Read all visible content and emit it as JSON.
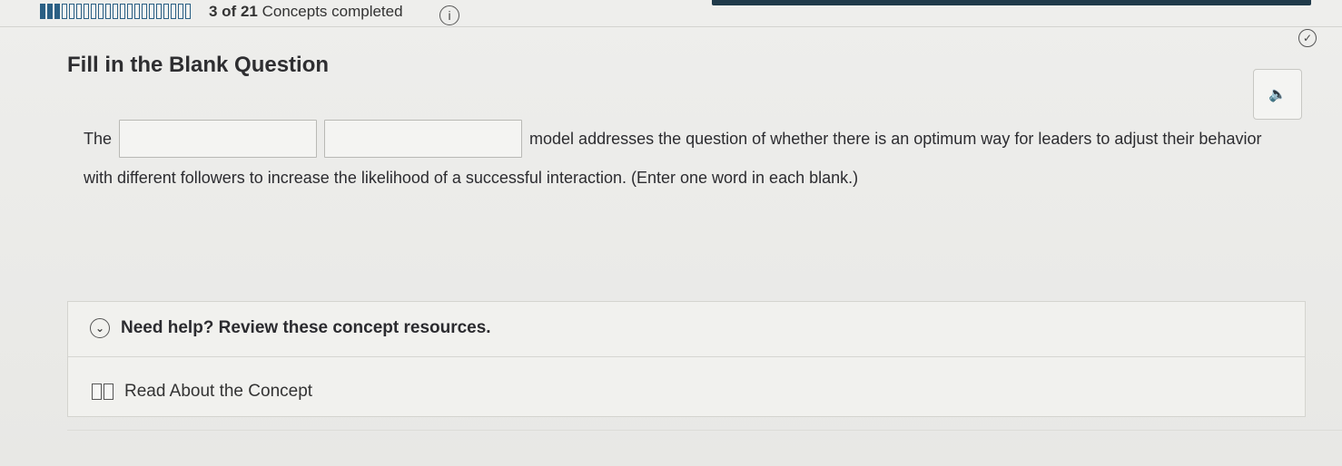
{
  "header": {
    "progress_completed": 3,
    "progress_total": 21,
    "progress_label_bold": "3 of 21",
    "progress_label_rest": "Concepts completed",
    "info_icon": "i",
    "accent_color": "#203a4a",
    "progress_color": "#2a5f84"
  },
  "question": {
    "title": "Fill in the Blank Question",
    "prompt_start": "The",
    "blank_1_value": "",
    "blank_2_value": "",
    "prompt_middle": "model addresses the question of whether there is an optimum way for leaders to adjust their behavior",
    "prompt_end": "with different followers to increase the likelihood of a successful interaction. (Enter one word in each blank.)",
    "audio_icon": "speaker-icon"
  },
  "help": {
    "heading": "Need help? Review these concept resources.",
    "resources": [
      {
        "label": "Read About the Concept",
        "icon": "book-icon"
      }
    ]
  }
}
